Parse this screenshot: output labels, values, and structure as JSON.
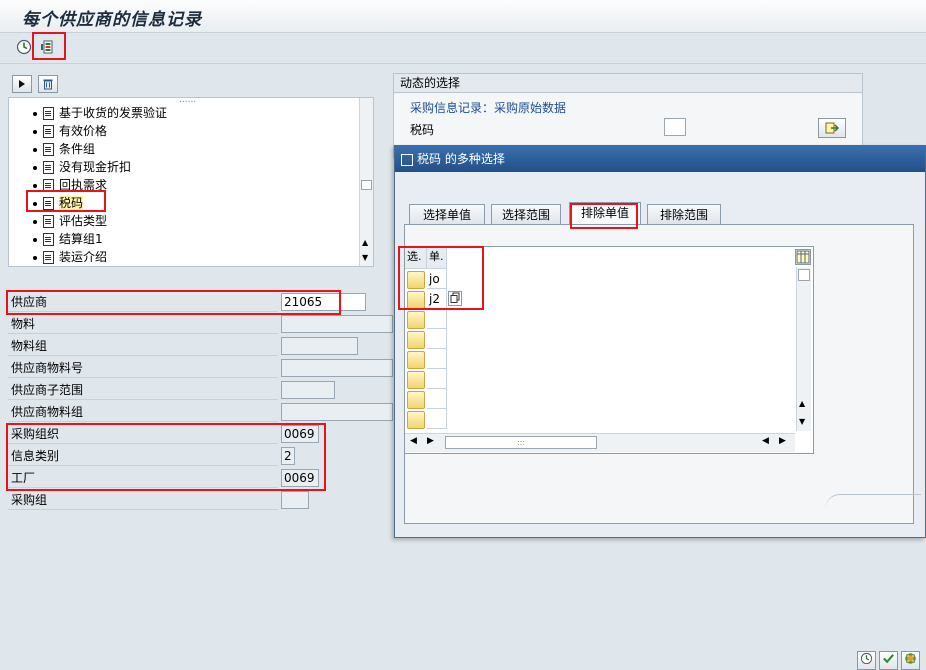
{
  "window": {
    "title": "每个供应商的信息记录"
  },
  "toolbar": {
    "execute_icon": "clock-execute-icon",
    "selection_icon": "selection-screen-icon"
  },
  "tree": {
    "handle": "......",
    "items": [
      {
        "label": "基于收货的发票验证"
      },
      {
        "label": "有效价格"
      },
      {
        "label": "条件组"
      },
      {
        "label": "没有现金折扣"
      },
      {
        "label": "回执需求"
      },
      {
        "label": "税码"
      },
      {
        "label": "评估类型"
      },
      {
        "label": "结算组1"
      },
      {
        "label": "装运介绍"
      }
    ]
  },
  "fields": [
    {
      "label": "供应商",
      "value": "21065"
    },
    {
      "label": "物料",
      "value": ""
    },
    {
      "label": "物料组",
      "value": ""
    },
    {
      "label": "供应商物料号",
      "value": ""
    },
    {
      "label": "供应商子范围",
      "value": ""
    },
    {
      "label": "供应商物料组",
      "value": ""
    },
    {
      "label": "采购组织",
      "value": "0069"
    },
    {
      "label": "信息类别",
      "value": "2"
    },
    {
      "label": "工厂",
      "value": "0069"
    },
    {
      "label": "采购组",
      "value": ""
    }
  ],
  "dynamic_panel": {
    "title": "动态的选择",
    "subtitle": "采购信息记录：采购原始数据",
    "field_label": "税码",
    "field_value": ""
  },
  "dialog": {
    "title": "税码 的多种选择",
    "tabs": [
      {
        "label": "选择单值"
      },
      {
        "label": "选择范围"
      },
      {
        "label": "排除单值"
      },
      {
        "label": "排除范围"
      }
    ],
    "active_tab": 2,
    "grid": {
      "col_headers": [
        "选.",
        "单."
      ],
      "rows": [
        {
          "value": "jo"
        },
        {
          "value": "j2"
        },
        {
          "value": ""
        },
        {
          "value": ""
        },
        {
          "value": ""
        },
        {
          "value": ""
        },
        {
          "value": ""
        },
        {
          "value": ""
        }
      ],
      "scroll_handle": ":::"
    }
  },
  "colors": {
    "highlight": "#e8141b",
    "title_bar": "#2a5c98",
    "selected_item": "#fff4a8"
  }
}
